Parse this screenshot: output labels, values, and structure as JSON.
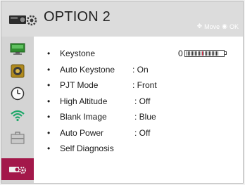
{
  "header": {
    "title": "OPTION 2",
    "hint": {
      "move_label": "Move",
      "ok_label": "OK"
    }
  },
  "sidebar": {
    "items": [
      {
        "icon": "monitor-icon"
      },
      {
        "icon": "speaker-icon"
      },
      {
        "icon": "clock-icon"
      },
      {
        "icon": "wifi-icon"
      },
      {
        "icon": "briefcase-icon"
      },
      {
        "icon": "projector-icon",
        "active": true
      }
    ]
  },
  "menu": {
    "bullet": "•",
    "items": [
      {
        "label": "Keystone",
        "value": "0"
      },
      {
        "label": "Auto Keystone",
        "value": ": On"
      },
      {
        "label": "PJT Mode",
        "value": ": Front"
      },
      {
        "label": "High Altitude",
        "value": ": Off"
      },
      {
        "label": "Blank Image",
        "value": ": Blue"
      },
      {
        "label": "Auto Power",
        "value": ": Off"
      },
      {
        "label": "Self Diagnosis",
        "value": ""
      }
    ]
  },
  "colors": {
    "active": "#a3184a",
    "slider_marker": "#c8102e"
  }
}
